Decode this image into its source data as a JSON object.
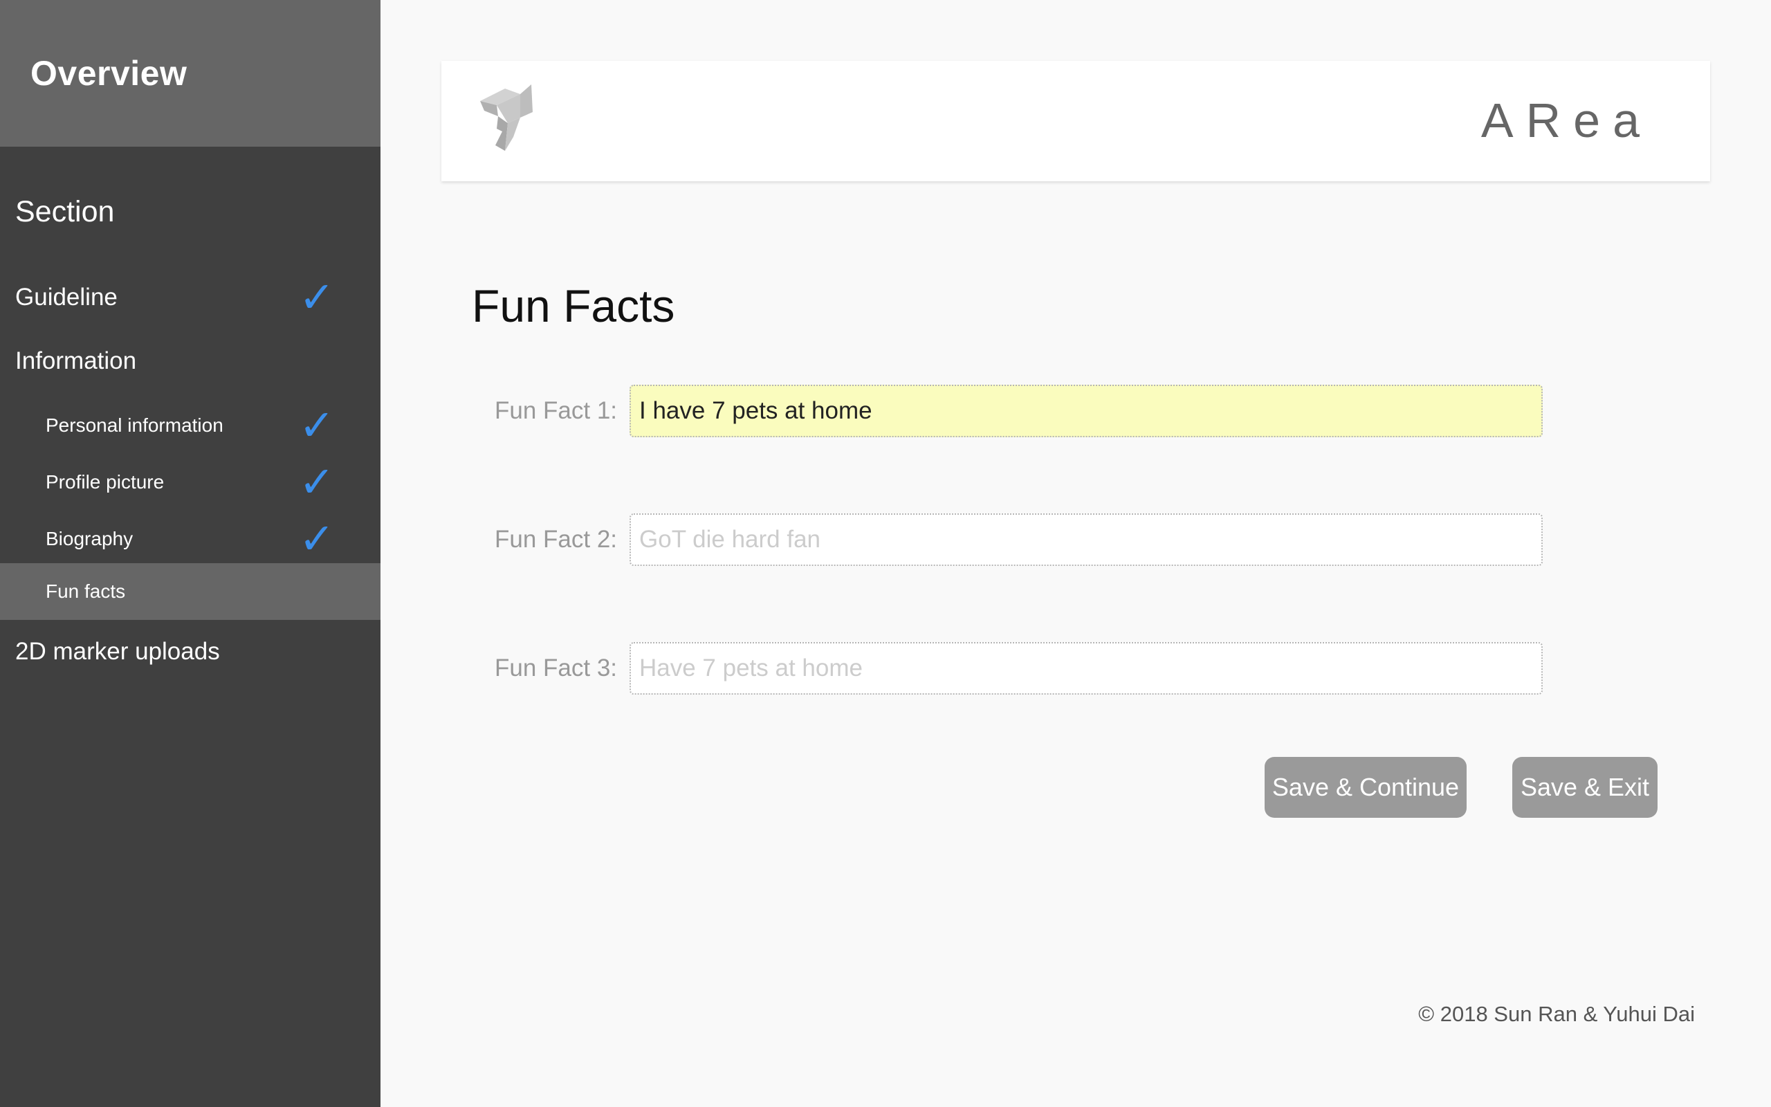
{
  "sidebar": {
    "title": "Overview",
    "section_heading": "Section",
    "items": [
      {
        "label": "Guideline",
        "completed": true
      },
      {
        "label": "Information",
        "completed": false
      },
      {
        "label": "Personal information",
        "completed": true
      },
      {
        "label": "Profile picture",
        "completed": true
      },
      {
        "label": "Biography",
        "completed": true
      },
      {
        "label": "Fun facts",
        "completed": false,
        "active": true
      },
      {
        "label": "2D marker uploads",
        "completed": false
      }
    ],
    "check_glyph": "✓",
    "check_color": "#3b8eea"
  },
  "header": {
    "logo_icon": "area-logo-icon",
    "brand": "ARea"
  },
  "main": {
    "title": "Fun Facts",
    "fields": [
      {
        "label": "Fun Fact 1:",
        "value": "I have 7 pets at home",
        "placeholder": ""
      },
      {
        "label": "Fun Fact 2:",
        "value": "",
        "placeholder": "GoT die hard fan"
      },
      {
        "label": "Fun Fact 3:",
        "value": "",
        "placeholder": "Have 7 pets at home"
      }
    ],
    "buttons": {
      "save_continue": "Save & Continue",
      "save_exit": "Save & Exit"
    }
  },
  "footer": {
    "copyright": "© 2018 Sun Ran & Yuhui Dai"
  }
}
